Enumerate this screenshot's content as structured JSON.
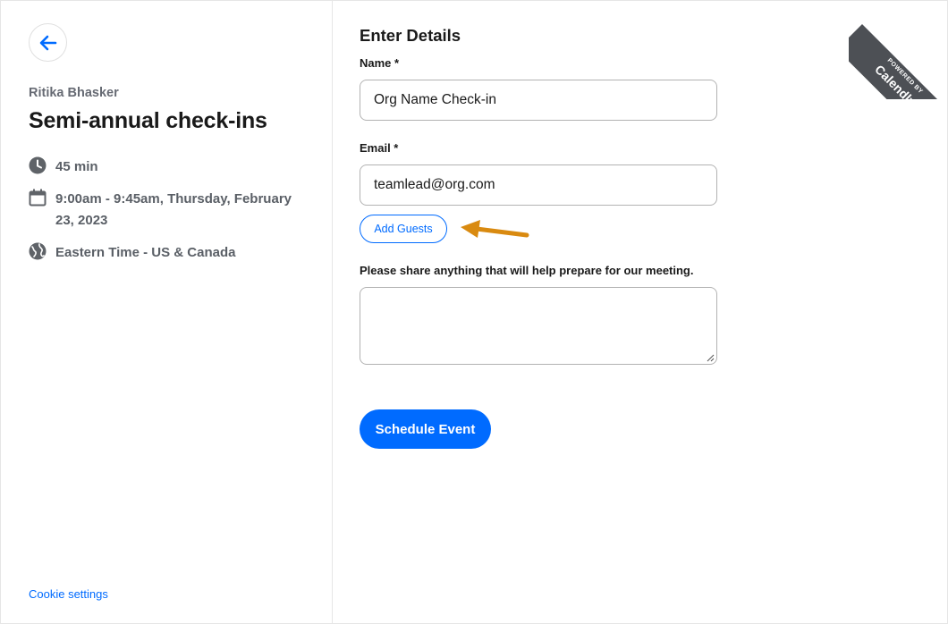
{
  "sidebar": {
    "organizer": "Ritika Bhasker",
    "event_title": "Semi-annual check-ins",
    "duration": "45 min",
    "datetime": "9:00am - 9:45am, Thursday, February 23, 2023",
    "timezone": "Eastern Time - US & Canada",
    "cookie_settings": "Cookie settings"
  },
  "form": {
    "heading": "Enter Details",
    "name_label": "Name *",
    "name_value": "Org Name Check-in",
    "email_label": "Email *",
    "email_value": "teamlead@org.com",
    "add_guests": "Add Guests",
    "notes_label": "Please share anything that will help prepare for our meeting.",
    "notes_value": "",
    "submit": "Schedule Event"
  },
  "ribbon": {
    "small": "POWERED BY",
    "brand": "Calendly"
  },
  "colors": {
    "accent": "#006bff",
    "annotation_arrow": "#d98a10",
    "ribbon_bg": "#4d5055"
  },
  "icons": {
    "back": "arrow-left-icon",
    "duration": "clock-icon",
    "datetime": "calendar-icon",
    "timezone": "globe-icon"
  }
}
